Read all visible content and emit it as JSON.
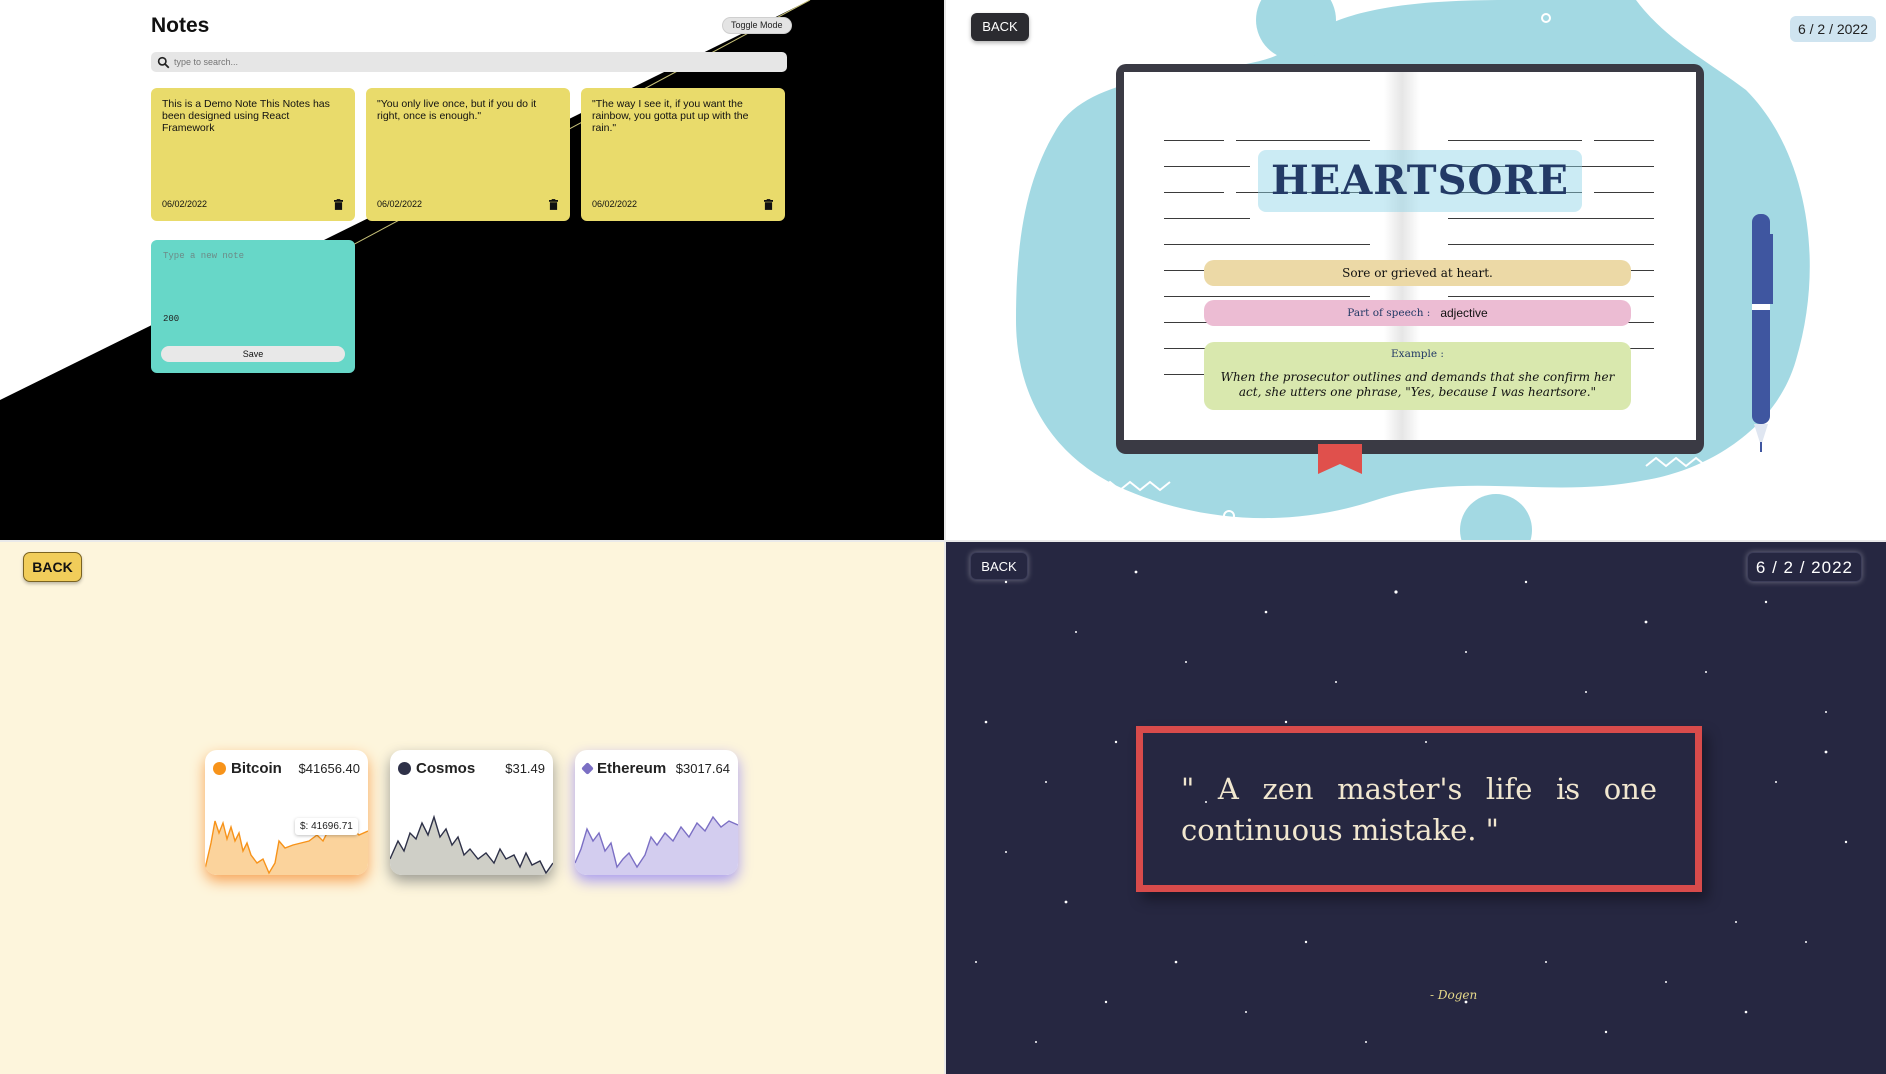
{
  "notes_app": {
    "title": "Notes",
    "toggle_label": "Toggle Mode",
    "search_placeholder": "type to search...",
    "notes": [
      {
        "text": "This is a Demo Note This Notes has been designed using React Framework",
        "date": "06/02/2022"
      },
      {
        "text": "\"You only live once, but if you do it right, once is enough.\"",
        "date": "06/02/2022"
      },
      {
        "text": "\"The way I see it, if you want the rainbow, you gotta put up with the rain.\"",
        "date": "06/02/2022"
      }
    ],
    "new_note": {
      "placeholder": "Type a new note",
      "char_count": "200",
      "save_label": "Save"
    }
  },
  "dictionary": {
    "back_label": "BACK",
    "date": "6 / 2 / 2022",
    "word": "HEARTSORE",
    "definition": "Sore or grieved at heart.",
    "part_of_speech_label": "Part of speech :",
    "part_of_speech": "adjective",
    "example_label": "Example :",
    "example": "When the prosecutor outlines and demands that she confirm her act, she utters one phrase, \"Yes, because I was heartsore.\""
  },
  "crypto": {
    "back_label": "BACK",
    "coins": [
      {
        "name": "Bitcoin",
        "price": "$41656.40",
        "color": "#f7931a",
        "fill": "#fbd39c",
        "shadow": "#f7a55a"
      },
      {
        "name": "Cosmos",
        "price": "$31.49",
        "color": "#2e3148",
        "fill": "#cfcfc7",
        "shadow": "#9a9a92"
      },
      {
        "name": "Ethereum",
        "price": "$3017.64",
        "color": "#7b6fc4",
        "fill": "#d3cdef",
        "shadow": "#a89cf0"
      }
    ],
    "tooltip": "$: 41696.71"
  },
  "quote": {
    "back_label": "BACK",
    "date": "6 / 2 / 2022",
    "text": "\" A zen master's life is one continuous mistake. \"",
    "author": "- Dogen"
  }
}
